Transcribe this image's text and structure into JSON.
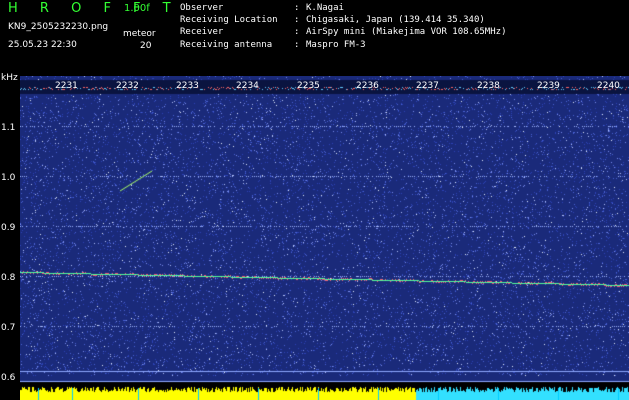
{
  "header": {
    "app_title": "H R O F F T",
    "version": "1.00f",
    "filename": "KN9_2505232230.png",
    "datetime": "25.05.23 22:30",
    "mode_label": "meteor",
    "mode_value": "20"
  },
  "info": [
    {
      "key": "Observer",
      "value": "K.Nagai"
    },
    {
      "key": "Receiving Location",
      "value": "Chigasaki, Japan (139.414 35.340)"
    },
    {
      "key": "Receiver",
      "value": "AirSpy mini (Miakejima VOR 108.65MHz)"
    },
    {
      "key": "Receiving antenna",
      "value": "Maspro FM-3"
    }
  ],
  "axis": {
    "unit": "kHz",
    "ticks": [
      "1.1",
      "1.0",
      "0.9",
      "0.8",
      "0.7",
      "0.6"
    ]
  },
  "frames": [
    "2231",
    "2232",
    "2233",
    "2234",
    "2235",
    "2236",
    "2237",
    "2238",
    "2239",
    "2240"
  ],
  "colors": {
    "background": "#1a2a7a",
    "carrier": "#55ff99",
    "grid": "#9fb4ff",
    "level": "#ffff00",
    "level_alt": "#33e0ff",
    "title": "#33ff33"
  }
}
